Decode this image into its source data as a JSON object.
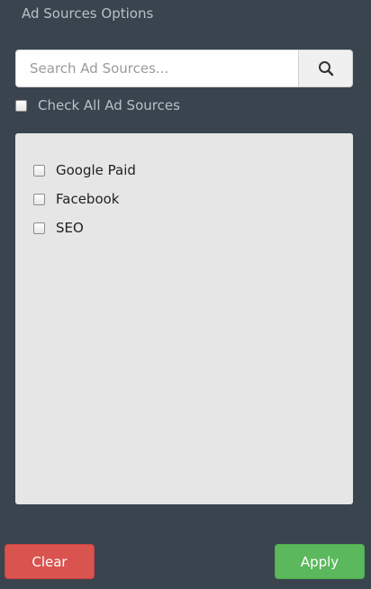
{
  "panel": {
    "title": "Ad Sources Options"
  },
  "search": {
    "placeholder": "Search Ad Sources...",
    "value": "",
    "icon": "search-icon"
  },
  "check_all": {
    "label": "Check All Ad Sources",
    "checked": false
  },
  "sources": [
    {
      "label": "Google Paid",
      "checked": false
    },
    {
      "label": "Facebook",
      "checked": false
    },
    {
      "label": "SEO",
      "checked": false
    }
  ],
  "actions": {
    "clear_label": "Clear",
    "apply_label": "Apply"
  },
  "colors": {
    "background": "#3a444f",
    "clear": "#d9534f",
    "apply": "#5cb85c",
    "list_bg": "#e6e6e6"
  }
}
